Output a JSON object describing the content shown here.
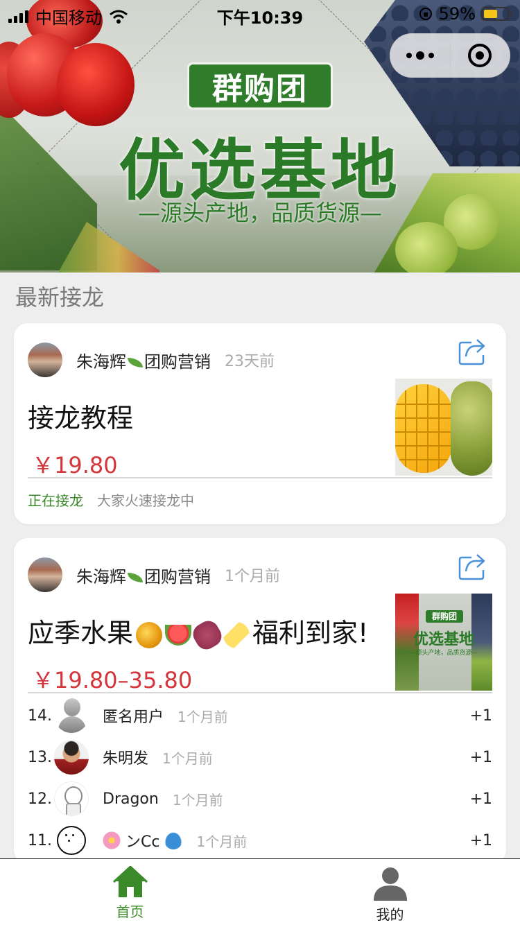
{
  "status_bar": {
    "carrier": "中国移动",
    "time": "下午10:39",
    "battery": "59%",
    "battery_level": 0.59
  },
  "banner": {
    "badge": "群购团",
    "title": "优选基地",
    "subtitle": "—源头产地，品质货源—"
  },
  "section": {
    "title": "最新接龙"
  },
  "cards": [
    {
      "author": "朱海辉",
      "author_suffix": "团购营销",
      "time": "23天前",
      "title": "接龙教程",
      "price": "￥19.80",
      "status": "正在接龙",
      "status_desc": "大家火速接龙中"
    },
    {
      "author": "朱海辉",
      "author_suffix": "团购营销",
      "time": "1个月前",
      "title_start": "应季水果",
      "title_end": "福利到家!",
      "price": "￥19.80–35.80",
      "thumb_badge": "群购团",
      "thumb_title": "优选基地",
      "thumb_sub": "—源头产地，品质货源—",
      "participants": [
        {
          "index": "14.",
          "name": "匿名用户",
          "time": "1个月前",
          "count": "+1"
        },
        {
          "index": "13.",
          "name": "朱明发",
          "time": "1个月前",
          "count": "+1"
        },
        {
          "index": "12.",
          "name": "Dragon",
          "time": "1个月前",
          "count": "+1"
        },
        {
          "index": "11.",
          "name": "ンCc",
          "time": "1个月前",
          "count": "+1"
        }
      ]
    }
  ],
  "tabbar": {
    "home": "首页",
    "mine": "我的"
  },
  "colors": {
    "accent_green": "#3a8a2a",
    "price_red": "#d2363b",
    "share_blue": "#4a90d9"
  }
}
